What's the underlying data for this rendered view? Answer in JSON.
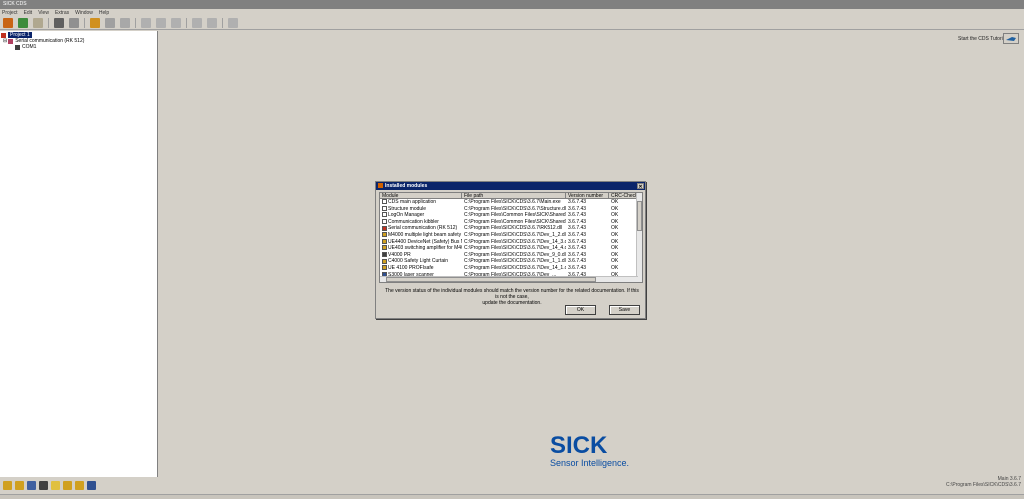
{
  "window": {
    "title": "SICK CDS"
  },
  "menu": [
    "Project",
    "Edit",
    "View",
    "Extras",
    "Window",
    "Help"
  ],
  "tree": {
    "project": "Project 1",
    "serial": "Serial communication (RK 512)",
    "com": "COM1"
  },
  "tutorial": {
    "label": "Start the CDS Tutorial"
  },
  "logo": {
    "brand": "SICK",
    "tagline": "Sensor Intelligence."
  },
  "version_info": {
    "line1": "Main 3.6.7",
    "line2": "C:\\Program Files\\SICK\\CDS\\3.6.7"
  },
  "dialog": {
    "title": "Installed modules",
    "columns": [
      "Module",
      "File path",
      "Version number",
      "CRC-Check"
    ],
    "rows": [
      {
        "module": "CDS main application",
        "path": "C:\\Program Files\\SICK\\CDS\\3.6.7\\Main.exe",
        "version": "3.6.7.43",
        "crc": "OK"
      },
      {
        "module": "Structure module",
        "path": "C:\\Program Files\\SICK\\CDS\\3.6.7\\Structure.dll",
        "version": "3.6.7.43",
        "crc": "OK"
      },
      {
        "module": "LogOn Manager",
        "path": "C:\\Program Files\\Common Files\\SICK\\Shared\\Log...",
        "version": "3.6.7.43",
        "crc": "OK"
      },
      {
        "module": "Communication kibbler",
        "path": "C:\\Program Files\\Common Files\\SICK\\Shared\\RK5...",
        "version": "3.6.7.43",
        "crc": "OK"
      },
      {
        "module": "Serial communication (RK 512)",
        "path": "C:\\Program Files\\SICK\\CDS\\3.6.7\\RK512.dll",
        "version": "3.6.7.43",
        "crc": "OK"
      },
      {
        "module": "M4000 multiple light beam safety d...",
        "path": "C:\\Program Files\\SICK\\CDS\\3.6.7\\Dev_1_2.dll",
        "version": "3.6.7.43",
        "crc": "OK"
      },
      {
        "module": "UE4400 DeviceNet (Safety) Bus N...",
        "path": "C:\\Program Files\\SICK\\CDS\\3.6.7\\Dev_14_3.dll",
        "version": "3.6.7.43",
        "crc": "OK"
      },
      {
        "module": "UE403 switching amplifier for M4000",
        "path": "C:\\Program Files\\SICK\\CDS\\3.6.7\\Dev_14_4.dll",
        "version": "3.6.7.43",
        "crc": "OK"
      },
      {
        "module": "V4000 PR",
        "path": "C:\\Program Files\\SICK\\CDS\\3.6.7\\Dev_9_0.dll",
        "version": "3.6.7.43",
        "crc": "OK"
      },
      {
        "module": "C4000 Safety Light Curtain",
        "path": "C:\\Program Files\\SICK\\CDS\\3.6.7\\Dev_1_1.dll",
        "version": "3.6.7.43",
        "crc": "OK"
      },
      {
        "module": "UE 4100 PROFIsafe",
        "path": "C:\\Program Files\\SICK\\CDS\\3.6.7\\Dev_14_1.dll",
        "version": "3.6.7.43",
        "crc": "OK"
      },
      {
        "module": "S3000 laser scanner",
        "path": "C:\\Program Files\\SICK\\CDS\\3.6.7\\Dev_...",
        "version": "3.6.7.43",
        "crc": "OK"
      }
    ],
    "note_line1": "The version status of the individual modules should match the version number for the related documentation. If this is not the case,",
    "note_line2": "update the documentation.",
    "ok_label": "OK",
    "save_label": "Save"
  },
  "colors": {
    "accent": "#0a246a",
    "brand": "#0a4da2",
    "background": "#d4d0c8"
  }
}
